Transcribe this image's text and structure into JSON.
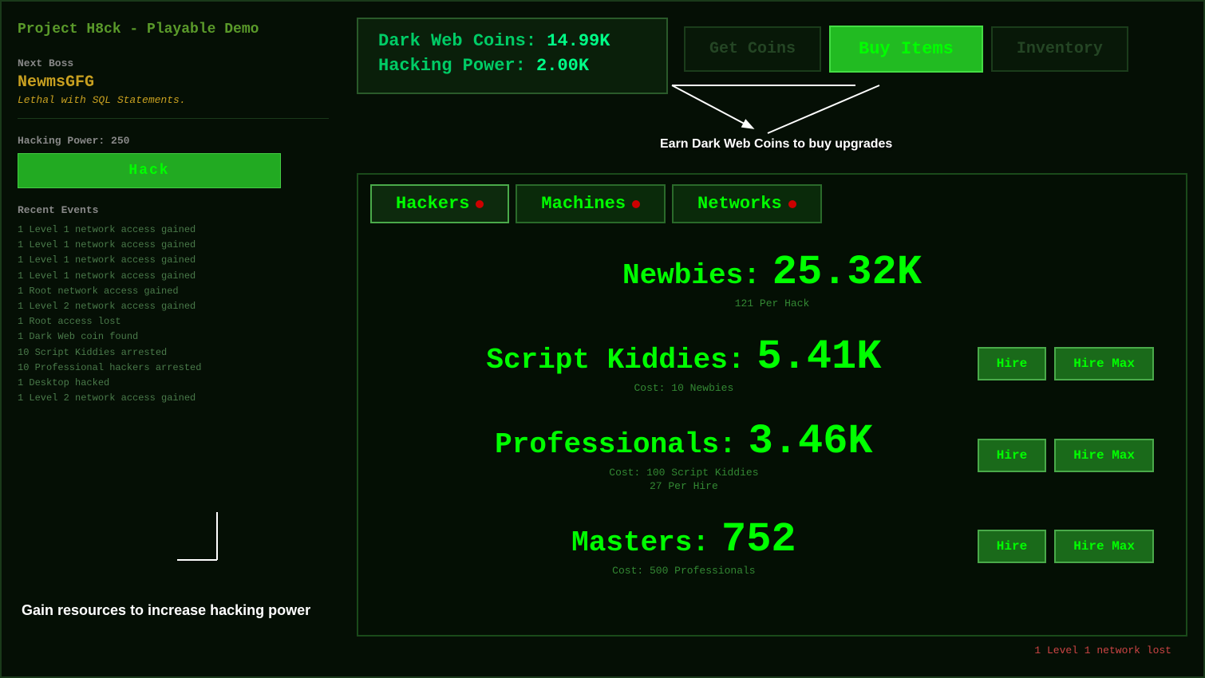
{
  "app": {
    "title": "Project H8ck - Playable Demo"
  },
  "sidebar": {
    "next_boss_label": "Next Boss",
    "boss_name": "NewmsGFG",
    "boss_desc": "Lethal with SQL Statements.",
    "hacking_power_label": "Hacking Power: 250",
    "hack_button": "Hack",
    "recent_events_label": "Recent Events",
    "events": [
      "1 Level 1 network access gained",
      "1 Level 1 network access gained",
      "1 Level 1 network access gained",
      "1 Level 1 network access gained",
      "1 Root network access gained",
      "1 Level 2 network access gained",
      "1 Root access lost",
      "1 Dark Web coin found",
      "10 Script Kiddies arrested",
      "10 Professional hackers arrested",
      "1 Desktop hacked",
      "1 Level 2 network access gained"
    ]
  },
  "stats": {
    "coins_label": "Dark Web Coins:",
    "coins_value": "14.99K",
    "power_label": "Hacking Power:",
    "power_value": "2.00K"
  },
  "header_buttons": {
    "get_coins": "Get Coins",
    "buy_items": "Buy Items",
    "inventory": "Inventory"
  },
  "annotations": {
    "earn_coins": "Earn Dark Web Coins to buy upgrades",
    "gain_resources": "Gain resources to\nincrease hacking power"
  },
  "tabs": [
    {
      "label": "Hackers",
      "has_dot": true,
      "active": true
    },
    {
      "label": "Machines",
      "has_dot": true,
      "active": false
    },
    {
      "label": "Networks",
      "has_dot": true,
      "active": false
    }
  ],
  "hackers": [
    {
      "name": "Newbies:",
      "count": "25.32K",
      "sub1": "121 Per Hack",
      "sub2": "",
      "show_buttons": false
    },
    {
      "name": "Script Kiddies:",
      "count": "5.41K",
      "sub1": "Cost: 10 Newbies",
      "sub2": "",
      "show_buttons": true
    },
    {
      "name": "Professionals:",
      "count": "3.46K",
      "sub1": "Cost: 100 Script Kiddies",
      "sub2": "27 Per Hire",
      "show_buttons": true
    },
    {
      "name": "Masters:",
      "count": "752",
      "sub1": "Cost: 500 Professionals",
      "sub2": "",
      "show_buttons": true
    }
  ],
  "buttons": {
    "hire": "Hire",
    "hire_max": "Hire Max"
  },
  "status_bar": {
    "message": "1 Level 1 network lost"
  }
}
